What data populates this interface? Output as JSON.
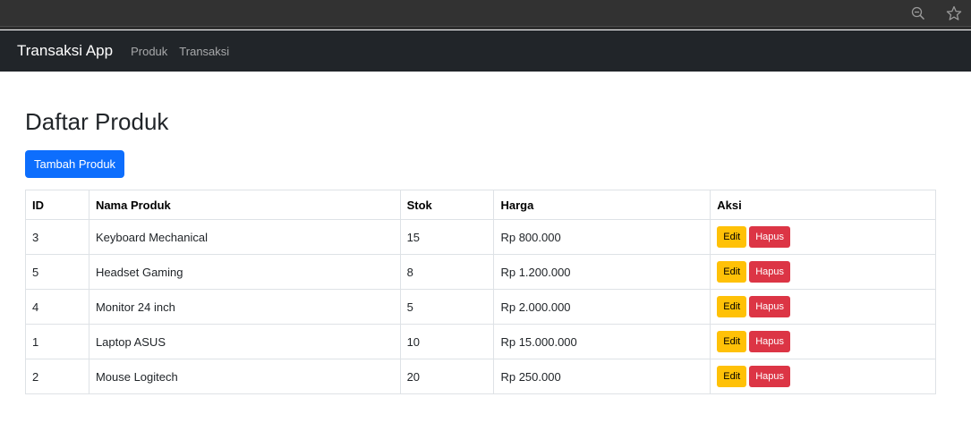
{
  "browser": {
    "zoom_icon": "zoom-out-icon",
    "star_icon": "star-icon"
  },
  "navbar": {
    "brand": "Transaksi App",
    "links": [
      "Produk",
      "Transaksi"
    ]
  },
  "page": {
    "title": "Daftar Produk",
    "add_button": "Tambah Produk"
  },
  "table": {
    "headers": [
      "ID",
      "Nama Produk",
      "Stok",
      "Harga",
      "Aksi"
    ],
    "rows": [
      {
        "id": "3",
        "name": "Keyboard Mechanical",
        "stok": "15",
        "harga": "Rp 800.000"
      },
      {
        "id": "5",
        "name": "Headset Gaming",
        "stok": "8",
        "harga": "Rp 1.200.000"
      },
      {
        "id": "4",
        "name": "Monitor 24 inch",
        "stok": "5",
        "harga": "Rp 2.000.000"
      },
      {
        "id": "1",
        "name": "Laptop ASUS",
        "stok": "10",
        "harga": "Rp 15.000.000"
      },
      {
        "id": "2",
        "name": "Mouse Logitech",
        "stok": "20",
        "harga": "Rp 250.000"
      }
    ],
    "edit_label": "Edit",
    "delete_label": "Hapus"
  },
  "colors": {
    "navbar_bg": "#212529",
    "primary": "#0d6efd",
    "warning": "#ffc107",
    "danger": "#dc3545"
  }
}
